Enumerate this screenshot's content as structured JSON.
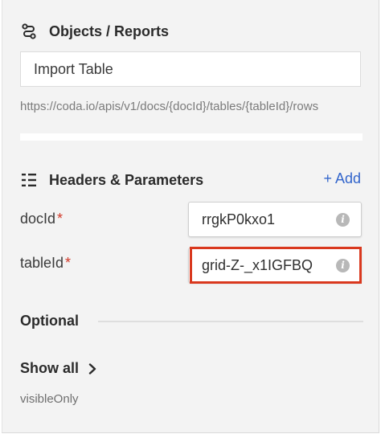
{
  "objects_section": {
    "title": "Objects / Reports",
    "icon": "route-icon",
    "name_value": "Import Table",
    "url": "https://coda.io/apis/v1/docs/{docId}/tables/{tableId}/rows"
  },
  "headers_section": {
    "title": "Headers & Parameters",
    "icon": "list-icon",
    "add_label": "+ Add"
  },
  "params": [
    {
      "label": "docId",
      "required_mark": "*",
      "value": "rrgkP0kxo1",
      "info_icon": "info-icon"
    },
    {
      "label": "tableId",
      "required_mark": "*",
      "value": "grid-Z-_x1IGFBQ",
      "info_icon": "info-icon"
    }
  ],
  "optional": {
    "label": "Optional",
    "show_all_label": "Show all",
    "show_all_icon": "chevron-right-icon",
    "items": [
      "visibleOnly"
    ]
  },
  "colors": {
    "panel_bg": "#f3f3f3",
    "link": "#3366cc",
    "required": "#d23a2a",
    "highlight": "#d9381e"
  }
}
